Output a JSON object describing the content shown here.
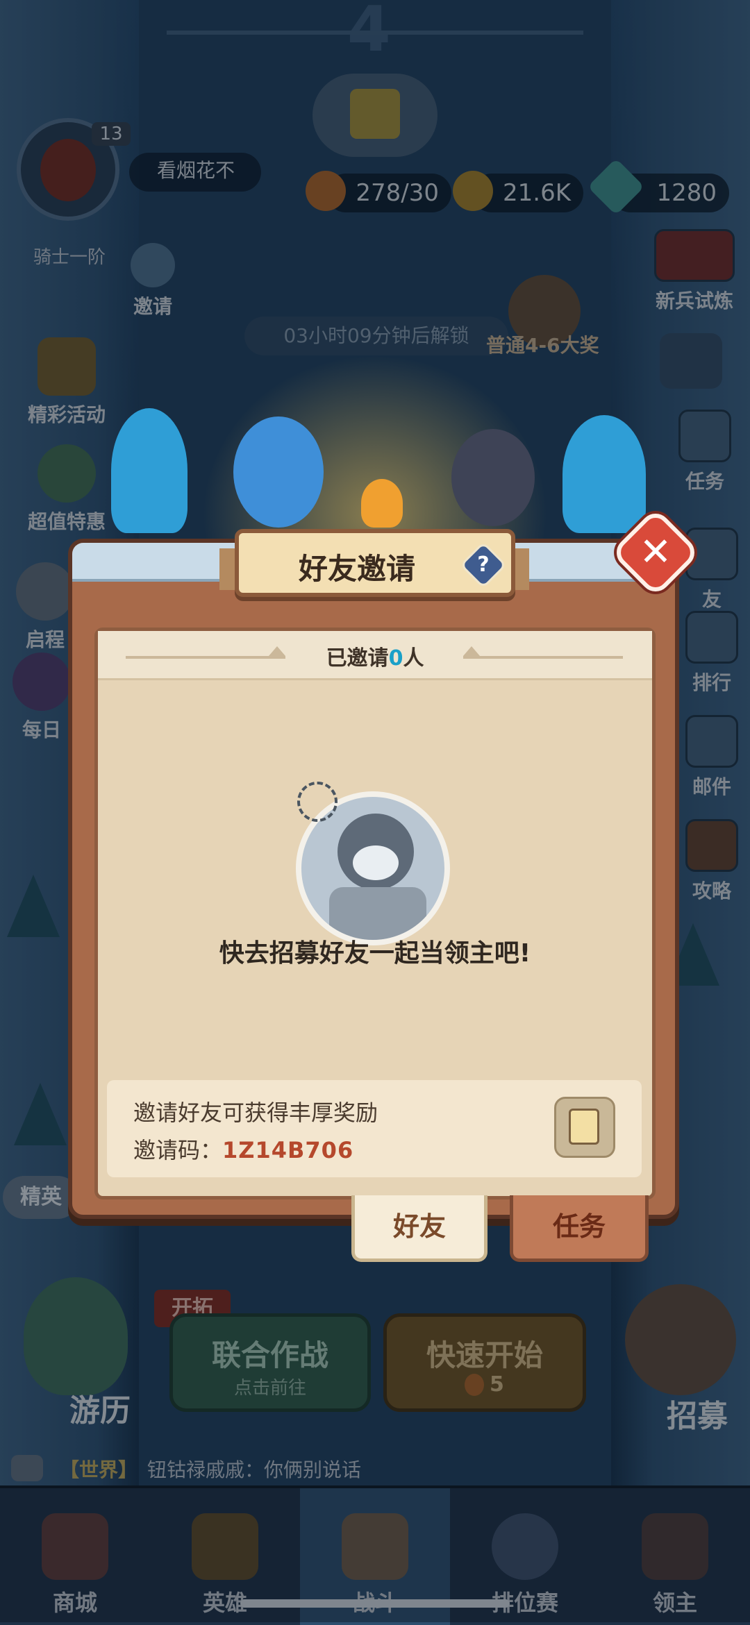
{
  "hud": {
    "level_number": "4",
    "player_name": "看烟花不",
    "player_level": "13",
    "rank_label": "骑士一阶",
    "stamina": "278/30",
    "gold": "21.6K",
    "gems": "1280",
    "unlock_timer": "03小时09分钟后解锁",
    "reward_hint": "普通4-6大奖"
  },
  "left_menu": [
    "邀请",
    "精彩活动",
    "超值特惠",
    "启程",
    "每日"
  ],
  "right_menu": [
    "新兵试炼",
    "任务",
    "友",
    "排行",
    "邮件",
    "攻略"
  ],
  "scene": {
    "elite_label": "精英",
    "open_label": "开拓",
    "coop_battle": "联合作战",
    "coop_sub": "点击前往",
    "quick_start": "快速开始",
    "quick_cost": "5",
    "travel": "游历",
    "recruit": "招募",
    "chat_channel": "【世界】",
    "chat_message": "钮钴禄戚戚：你俩别说话"
  },
  "bottom_nav": [
    "商城",
    "英雄",
    "战斗",
    "排位赛",
    "领主"
  ],
  "dialog": {
    "title": "好友邀请",
    "help": "?",
    "close": "✕",
    "invited_prefix": "已邀请",
    "invited_count": "0",
    "invited_suffix": "人",
    "empty_message": "快去招募好友一起当领主吧!",
    "reward_text": "邀请好友可获得丰厚奖励",
    "code_label": "邀请码：",
    "code_value": "1Z14B706",
    "tab_friends": "好友",
    "tab_tasks": "任务"
  },
  "colors": {
    "dialog_wood": "#a86a4a",
    "panel_paper": "#e6d4b6",
    "close_red": "#d94a3a",
    "code_red": "#b5482c",
    "count_blue": "#1aa0c8"
  }
}
